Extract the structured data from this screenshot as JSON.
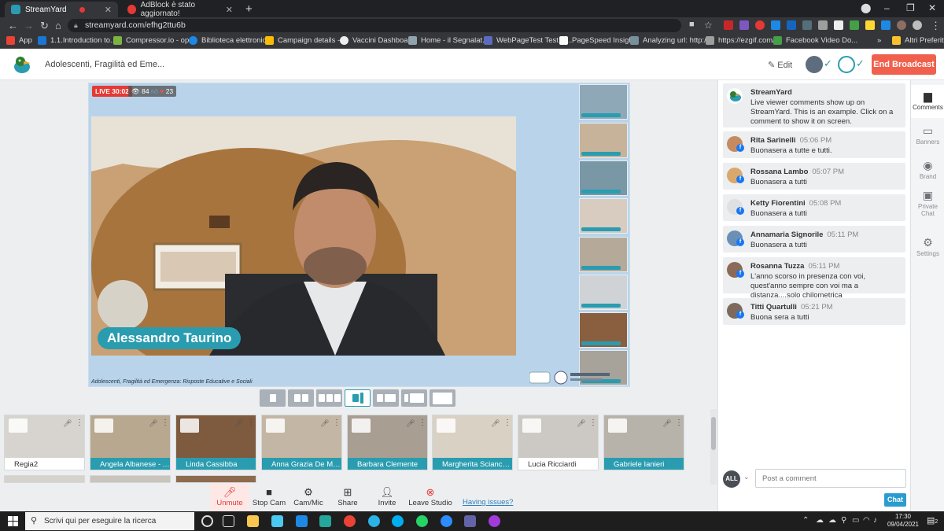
{
  "browser": {
    "tabs": [
      {
        "title": "StreamYard",
        "active": true
      },
      {
        "title": "AdBlock è stato aggiornato!",
        "active": false
      }
    ],
    "url": "streamyard.com/efhg2ttu6b",
    "bookmarks": [
      "App",
      "1.1.Introduction to...",
      "Compressor.io - op...",
      "Biblioteca elettronic...",
      "Campaign details -...",
      "Vaccini Dashboard",
      "Home - il Segnalat...",
      "WebPageTest Test R...",
      "PageSpeed Insights",
      "Analyzing url: http:/...",
      "https://ezgif.com/",
      "Facebook Video Do..."
    ],
    "other_bookmarks": "Altri Preferiti"
  },
  "header": {
    "broadcast_title": "Adolescenti, Fragilità ed Eme...",
    "edit_label": "Edit",
    "end_label": "End Broadcast"
  },
  "stage": {
    "live_label": "LIVE 30:02",
    "viewer_count": "84",
    "reaction_count": "23",
    "speaker_name": "Alessandro Taurino",
    "lower_text": "Adolescenti, Fragilità ed Emergenza: Risposte Educative e Sociali"
  },
  "participants": [
    {
      "name": "Regia2",
      "on_stage": false
    },
    {
      "name": "Angela Albanese - An...",
      "on_stage": true
    },
    {
      "name": "Linda Cassibba",
      "on_stage": true
    },
    {
      "name": "Anna Grazia De Marzo",
      "on_stage": true
    },
    {
      "name": "Barbara Clemente",
      "on_stage": true
    },
    {
      "name": "Margherita Sciancale...",
      "on_stage": true
    },
    {
      "name": "Lucia Ricciardi",
      "on_stage": false
    },
    {
      "name": "Gabriele Ianieri",
      "on_stage": true
    }
  ],
  "controls": {
    "unmute": "Unmute",
    "stop_cam": "Stop Cam",
    "cam_mic": "Cam/Mic",
    "share": "Share",
    "invite": "Invite",
    "leave": "Leave Studio",
    "issues": "Having issues?"
  },
  "comments": [
    {
      "author": "StreamYard",
      "time": "",
      "text": "Live viewer comments show up on StreamYard. This is an example. Click on a comment to show it on screen."
    },
    {
      "author": "Rita Sarinelli",
      "time": "05:06 PM",
      "text": "Buonasera a tutte e tutti."
    },
    {
      "author": "Rossana Lambo",
      "time": "05:07 PM",
      "text": "Buonasera a tutti"
    },
    {
      "author": "Ketty Fiorentini",
      "time": "05:08 PM",
      "text": "Buonasera a tutti"
    },
    {
      "author": "Annamaria Signorile",
      "time": "05:11 PM",
      "text": "Buonasera a tutti"
    },
    {
      "author": "Rosanna Tuzza",
      "time": "05:11 PM",
      "text": "L'anno scorso in presenza con voi, quest'anno sempre con voi ma a distanza....solo chilometrica"
    },
    {
      "author": "Titti Quartulli",
      "time": "05:21 PM",
      "text": "Buona sera a tutti"
    }
  ],
  "chat": {
    "filter_label": "ALL",
    "placeholder": "Post a comment",
    "send_label": "Chat"
  },
  "rail": [
    {
      "label": "Comments",
      "icon": "comment-icon"
    },
    {
      "label": "Banners",
      "icon": "banner-icon"
    },
    {
      "label": "Brand",
      "icon": "palette-icon"
    },
    {
      "label": "Private Chat",
      "icon": "private-chat-icon"
    },
    {
      "label": "Settings",
      "icon": "gear-icon"
    }
  ],
  "taskbar": {
    "search_placeholder": "Scrivi qui per eseguire la ricerca",
    "time": "17:30",
    "date": "09/04/2021",
    "notification_count": "2"
  },
  "colors": {
    "accent": "#2a9cb0",
    "end_broadcast": "#f0604d",
    "live": "#e53935",
    "stage_bg": "#b9d4ea"
  }
}
